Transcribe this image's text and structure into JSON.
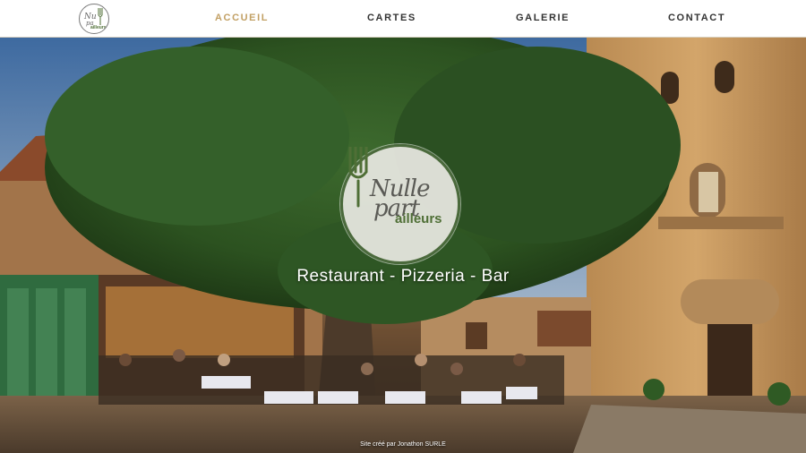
{
  "nav": {
    "items": [
      {
        "label": "ACCUEIL",
        "active": true
      },
      {
        "label": "CARTES",
        "active": false
      },
      {
        "label": "GALERIE",
        "active": false
      },
      {
        "label": "CONTACT",
        "active": false
      }
    ],
    "accent_color": "#c2a064"
  },
  "hero": {
    "logo": {
      "line1": "Nulle",
      "line2": "part",
      "line3": "ailleurs"
    },
    "tagline": "Restaurant - Pizzeria - Bar"
  },
  "footer": {
    "credit": "Site créé par Jonathon SURLE"
  }
}
